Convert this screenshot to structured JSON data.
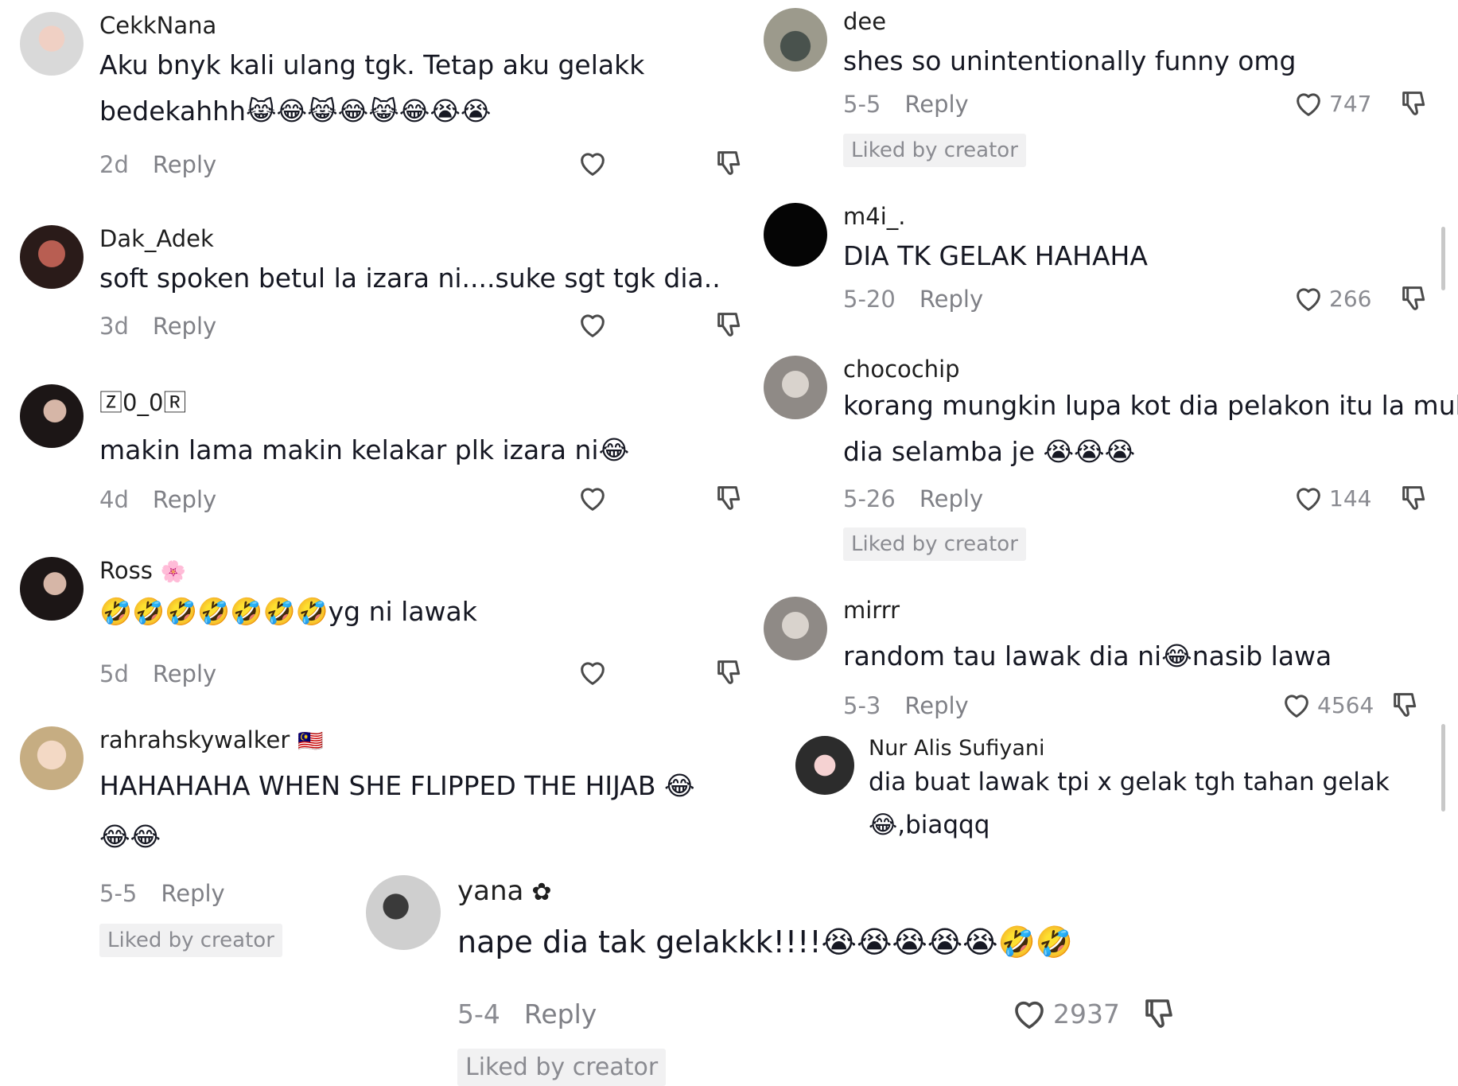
{
  "comments": [
    {
      "username": "CekkNana",
      "badge": "",
      "text_lines": [
        "Aku bnyk kali ulang tgk. Tetap aku gelakk",
        "bedekahhh😹😂😹😂😹😂😭😭"
      ],
      "time": "2d",
      "reply": "Reply",
      "likes": "",
      "liked_by_creator": ""
    },
    {
      "username": "Dak_Adek",
      "badge": "",
      "text_lines": [
        "soft spoken betul la izara ni....suke sgt tgk dia.."
      ],
      "time": "3d",
      "reply": "Reply",
      "likes": "",
      "liked_by_creator": ""
    },
    {
      "username": "🅉0_0🅁",
      "badge": "",
      "text_lines": [
        "makin lama makin kelakar plk izara ni😂"
      ],
      "time": "4d",
      "reply": "Reply",
      "likes": "",
      "liked_by_creator": ""
    },
    {
      "username": "Ross",
      "badge": "🌸",
      "text_lines": [
        "🤣🤣🤣🤣🤣🤣🤣yg ni lawak"
      ],
      "time": "5d",
      "reply": "Reply",
      "likes": "",
      "liked_by_creator": ""
    },
    {
      "username": "rahrahskywalker",
      "badge": "🇲🇾",
      "text_lines": [
        "HAHAHAHA WHEN SHE FLIPPED THE HIJAB 😂",
        "😂😂"
      ],
      "time": "5-5",
      "reply": "Reply",
      "likes": "",
      "liked_by_creator": "Liked by creator"
    },
    {
      "username": "dee",
      "badge": "",
      "text_lines": [
        "shes so unintentionally funny omg"
      ],
      "time": "5-5",
      "reply": "Reply",
      "likes": "747",
      "liked_by_creator": "Liked by creator"
    },
    {
      "username": "m4i_.",
      "badge": "",
      "text_lines": [
        "DIA TK GELAK HAHAHA"
      ],
      "time": "5-20",
      "reply": "Reply",
      "likes": "266",
      "liked_by_creator": ""
    },
    {
      "username": "chocochip",
      "badge": "",
      "text_lines": [
        "korang mungkin lupa kot dia pelakon itu la muka",
        "dia selamba je 😭😭😭"
      ],
      "time": "5-26",
      "reply": "Reply",
      "likes": "144",
      "liked_by_creator": "Liked by creator"
    },
    {
      "username": "mirrr",
      "badge": "",
      "text_lines": [
        "random tau lawak dia ni😂nasib lawa"
      ],
      "time": "5-3",
      "reply": "Reply",
      "likes": "4564",
      "liked_by_creator": ""
    },
    {
      "username": "Nur Alis Sufiyani",
      "badge": "",
      "text_lines": [
        "dia buat lawak tpi x gelak tgh tahan gelak",
        "😂,biaqqq"
      ],
      "time": "",
      "reply": "",
      "likes": "",
      "liked_by_creator": ""
    },
    {
      "username": "yana",
      "badge": "✿",
      "text_lines": [
        "nape dia tak gelakkk!!!!😭😭😭😭😭🤣🤣"
      ],
      "time": "5-4",
      "reply": "Reply",
      "likes": "2937",
      "liked_by_creator": "Liked by creator"
    }
  ],
  "icons": {
    "like": "heart-outline-icon",
    "dislike": "thumbs-down-icon"
  },
  "colors": {
    "text": "#161823",
    "muted": "#8a8b91",
    "badge_bg": "#f1f1f2"
  }
}
